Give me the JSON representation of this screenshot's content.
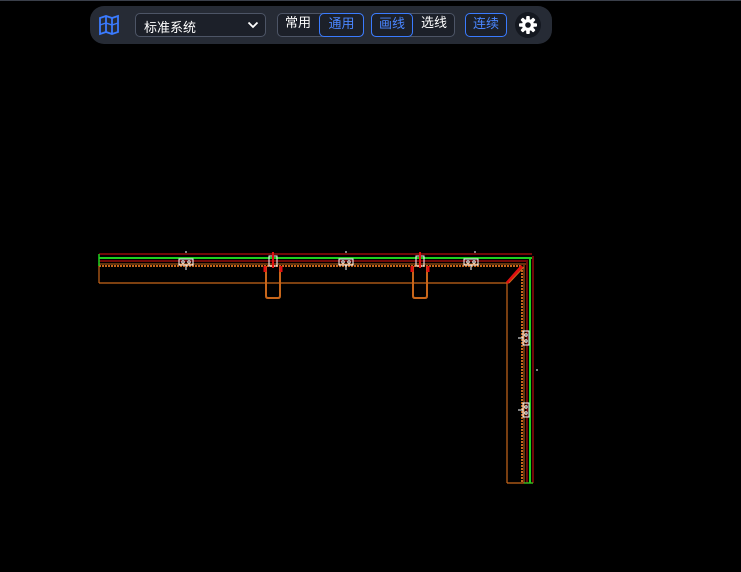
{
  "toolbar": {
    "logo_icon": "map-fold-icon",
    "system_select": {
      "value": "标准系统"
    },
    "mode_group": {
      "options": [
        "常用",
        "通用"
      ],
      "active": "通用"
    },
    "draw_group": {
      "options": [
        "画线",
        "选线"
      ],
      "active": "画线"
    },
    "continue_label": "连续",
    "settings_icon": "gear-icon"
  },
  "colors": {
    "accent": "#3a7bff",
    "toolbar_bg": "#262b35",
    "drawing_orange": "#c8661a",
    "drawing_green": "#20d020",
    "drawing_red": "#e01010"
  }
}
